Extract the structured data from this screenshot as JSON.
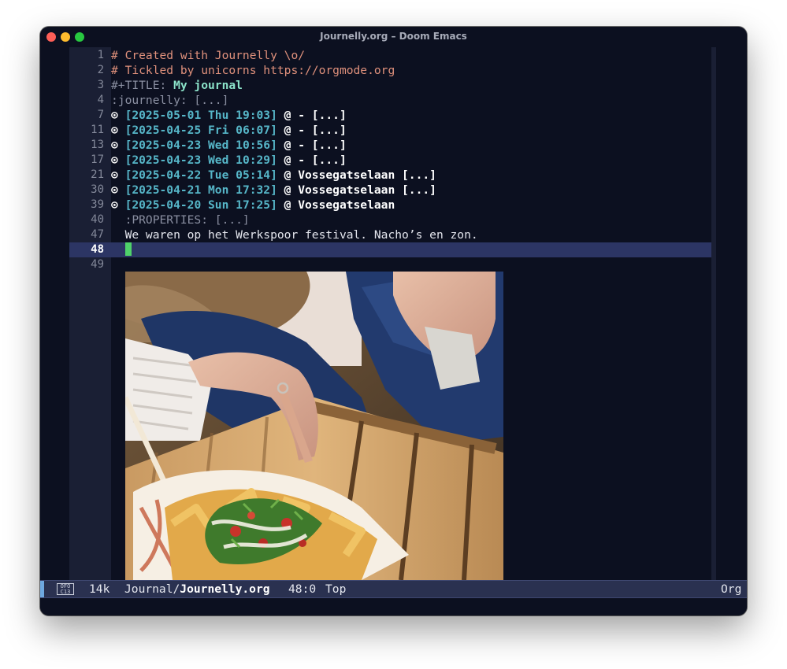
{
  "window": {
    "title": "Journelly.org – Doom Emacs"
  },
  "editor": {
    "lines": [
      {
        "num": "1",
        "kind": "comment",
        "text": "# Created with Journelly \\o/"
      },
      {
        "num": "2",
        "kind": "comment",
        "text": "# Tickled by unicorns https://orgmode.org"
      },
      {
        "num": "3",
        "kind": "title",
        "keyword": "#+TITLE: ",
        "title": "My journal"
      },
      {
        "num": "4",
        "kind": "drawer",
        "text": ":journelly: [...]"
      },
      {
        "num": "7",
        "kind": "heading",
        "bullet": "⊙ ",
        "date": "[2025-05-01 Thu 19:03]",
        "rest": " @ - [...]"
      },
      {
        "num": "11",
        "kind": "heading",
        "bullet": "⊙ ",
        "date": "[2025-04-25 Fri 06:07]",
        "rest": " @ - [...]"
      },
      {
        "num": "13",
        "kind": "heading",
        "bullet": "⊙ ",
        "date": "[2025-04-23 Wed 10:56]",
        "rest": " @ - [...]"
      },
      {
        "num": "17",
        "kind": "heading",
        "bullet": "⊙ ",
        "date": "[2025-04-23 Wed 10:29]",
        "rest": " @ - [...]"
      },
      {
        "num": "21",
        "kind": "heading",
        "bullet": "⊙ ",
        "date": "[2025-04-22 Tue 05:14]",
        "rest": " @ Vossegatselaan [...]"
      },
      {
        "num": "30",
        "kind": "heading",
        "bullet": "⊙ ",
        "date": "[2025-04-21 Mon 17:32]",
        "rest": " @ Vossegatselaan [...]"
      },
      {
        "num": "39",
        "kind": "heading",
        "bullet": "⊙ ",
        "date": "[2025-04-20 Sun 17:25]",
        "rest": " @ Vossegatselaan"
      },
      {
        "num": "40",
        "kind": "drawer",
        "text": "  :PROPERTIES: [...]"
      },
      {
        "num": "47",
        "kind": "body",
        "text": "  We waren op het Werkspoor festival. Nacho’s en zon."
      },
      {
        "num": "48",
        "kind": "current",
        "text": "  "
      },
      {
        "num": "49",
        "kind": "blank",
        "text": ""
      }
    ],
    "image": {
      "name": "nachos-photo"
    }
  },
  "modeline": {
    "icon_top": "OFO",
    "icon_bottom": "C13",
    "size": "14k",
    "dir": "Journal/",
    "file": "Journelly.org",
    "position": "48:0",
    "scroll": "Top",
    "mode": "Org"
  }
}
